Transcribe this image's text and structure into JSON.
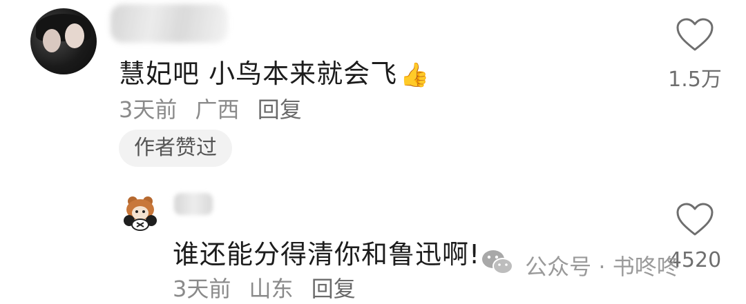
{
  "comments": [
    {
      "text": "慧妃吧 小鸟本来就会飞",
      "emoji": "👍",
      "time": "3天前",
      "location": "广西",
      "reply_label": "回复",
      "badge": "作者赞过",
      "likes": "1.5万"
    },
    {
      "text": "谁还能分得清你和鲁迅啊!",
      "time": "3天前",
      "location": "山东",
      "reply_label": "回复",
      "likes": "4520"
    }
  ],
  "watermark": {
    "text": "公众号 · 书咚咚"
  },
  "icons": {
    "heart": "heart-outline-icon",
    "wechat": "wechat-icon"
  }
}
